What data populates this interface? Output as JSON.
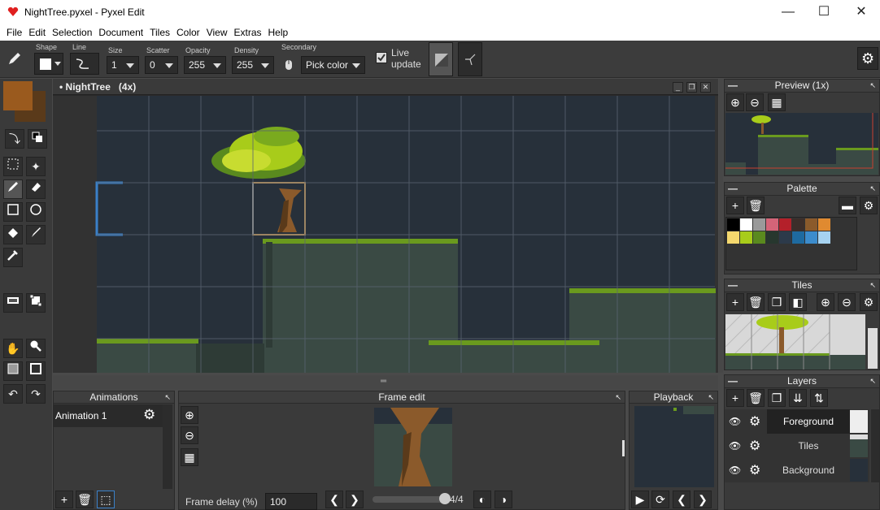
{
  "window": {
    "title": "NightTree.pyxel - Pyxel Edit",
    "minimize": "—",
    "maximize": "☐",
    "close": "✕"
  },
  "menu": [
    "File",
    "Edit",
    "Selection",
    "Document",
    "Tiles",
    "Color",
    "View",
    "Extras",
    "Help"
  ],
  "toolbar": {
    "shape_label": "Shape",
    "line_label": "Line",
    "size_label": "Size",
    "size_value": "1",
    "scatter_label": "Scatter",
    "scatter_value": "0",
    "opacity_label": "Opacity",
    "opacity_value": "255",
    "density_label": "Density",
    "density_value": "255",
    "secondary_label": "Secondary",
    "secondary_value": "Pick color",
    "live_update_label": "Live\nupdate",
    "live_update_checked": true
  },
  "canvas": {
    "title": "• NightTree",
    "zoom": "(4x)"
  },
  "preview": {
    "title": "Preview (1x)"
  },
  "palette": {
    "title": "Palette",
    "colors": [
      "#000000",
      "#ffffff",
      "#9a9a9a",
      "#d46478",
      "#b4202a",
      "#3c2e2a",
      "#8b5a2b",
      "#e08a30",
      "#f5d86e",
      "#a8cc1a",
      "#5a8a1e",
      "#27372e",
      "#2c3a4a",
      "#1e6aa0",
      "#3c8ccc",
      "#a6d2f0"
    ]
  },
  "tiles": {
    "title": "Tiles"
  },
  "layers": {
    "title": "Layers",
    "items": [
      {
        "name": "Foreground",
        "selected": true
      },
      {
        "name": "Tiles",
        "selected": false
      },
      {
        "name": "Background",
        "selected": false
      }
    ]
  },
  "animations": {
    "title": "Animations",
    "items": [
      "Animation 1"
    ]
  },
  "frame_edit": {
    "title": "Frame edit",
    "frame_delay_label": "Frame delay (%)",
    "frame_delay_value": "100",
    "frame_counter": "4/4"
  },
  "playback": {
    "title": "Playback"
  },
  "colors": {
    "primary": "#9a5a1e",
    "secondary": "#5a3a1a",
    "grass": "#6a9a1e",
    "ground": "#3a4a44",
    "sky": "#27303a"
  }
}
